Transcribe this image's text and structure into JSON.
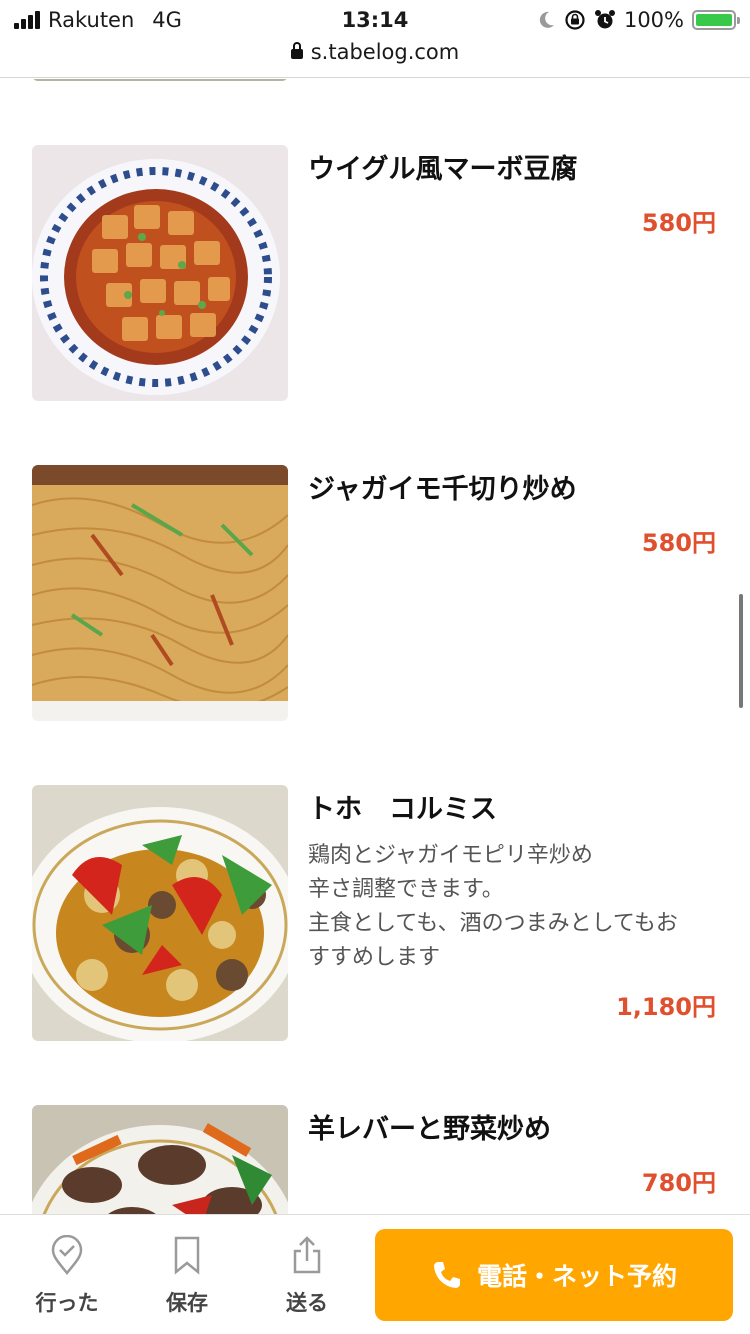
{
  "status_bar": {
    "carrier": "Rakuten",
    "network": "4G",
    "time": "13:14",
    "battery": "100%"
  },
  "browser": {
    "url": "s.tabelog.com"
  },
  "menu_items": [
    {
      "name": "ウイグル風マーボ豆腐",
      "price": "580円",
      "image": "mapo-tofu-photo"
    },
    {
      "name": "ジャガイモ千切り炒め",
      "price": "580円",
      "image": "potato-stir-fry-photo"
    },
    {
      "name": "トホ　コルミス",
      "description": [
        "鶏肉とジャガイモピリ辛炒め",
        "辛さ調整できます。",
        "主食としても、酒のつまみとしてもお",
        "すすめします"
      ],
      "price": "1,180円",
      "image": "chicken-potato-photo"
    },
    {
      "name": "羊レバーと野菜炒め",
      "price": "780円",
      "image": "lamb-liver-photo"
    }
  ],
  "toolbar": {
    "went_label": "行った",
    "save_label": "保存",
    "send_label": "送る",
    "reserve_label": "電話・ネット予約"
  },
  "colors": {
    "price": "#e0502e",
    "reserve_button": "#ffa600"
  }
}
